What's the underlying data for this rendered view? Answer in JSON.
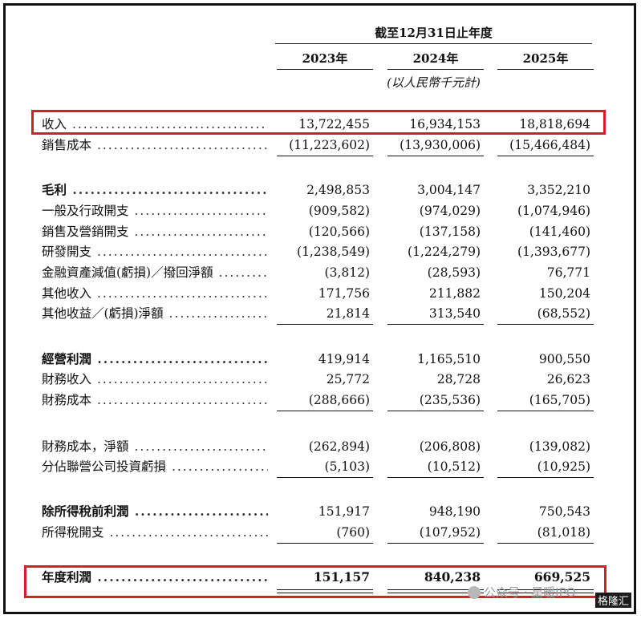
{
  "header": {
    "period": "截至12月31日止年度",
    "years": [
      "2023年",
      "2024年",
      "2025年"
    ],
    "unit": "(以人民幣千元計)"
  },
  "rows": [
    {
      "label": "收入",
      "bold": false,
      "values": [
        "13,722,455",
        "16,934,153",
        "18,818,694"
      ]
    },
    {
      "label": "銷售成本",
      "bold": false,
      "values": [
        "(11,223,602)",
        "(13,930,006)",
        "(15,466,484)"
      ]
    },
    {
      "label": "毛利",
      "bold": true,
      "values": [
        "2,498,853",
        "3,004,147",
        "3,352,210"
      ]
    },
    {
      "label": "一般及行政開支",
      "bold": false,
      "values": [
        "(909,582)",
        "(974,029)",
        "(1,074,946)"
      ]
    },
    {
      "label": "銷售及營銷開支",
      "bold": false,
      "values": [
        "(120,566)",
        "(137,158)",
        "(141,460)"
      ]
    },
    {
      "label": "研發開支",
      "bold": false,
      "values": [
        "(1,238,549)",
        "(1,224,279)",
        "(1,393,677)"
      ]
    },
    {
      "label": "金融資產減值(虧損)／撥回淨額",
      "bold": false,
      "values": [
        "(3,812)",
        "(28,593)",
        "76,771"
      ]
    },
    {
      "label": "其他收入",
      "bold": false,
      "values": [
        "171,756",
        "211,882",
        "150,204"
      ]
    },
    {
      "label": "其他收益／(虧損)淨額",
      "bold": false,
      "values": [
        "21,814",
        "313,540",
        "(68,552)"
      ]
    },
    {
      "label": "經營利潤",
      "bold": true,
      "values": [
        "419,914",
        "1,165,510",
        "900,550"
      ]
    },
    {
      "label": "財務收入",
      "bold": false,
      "values": [
        "25,772",
        "28,728",
        "26,623"
      ]
    },
    {
      "label": "財務成本",
      "bold": false,
      "values": [
        "(288,666)",
        "(235,536)",
        "(165,705)"
      ]
    },
    {
      "label": "財務成本，淨額",
      "bold": false,
      "values": [
        "(262,894)",
        "(206,808)",
        "(139,082)"
      ]
    },
    {
      "label": "分佔聯營公司投資虧損",
      "bold": false,
      "values": [
        "(5,103)",
        "(10,512)",
        "(10,925)"
      ]
    },
    {
      "label": "除所得稅前利潤",
      "bold": true,
      "values": [
        "151,917",
        "948,190",
        "750,543"
      ]
    },
    {
      "label": "所得稅開支",
      "bold": false,
      "values": [
        "(760)",
        "(107,952)",
        "(81,018)"
      ]
    },
    {
      "label": "年度利潤",
      "bold": true,
      "values": [
        "151,157",
        "840,238",
        "669,525"
      ]
    }
  ],
  "watermark": {
    "text": "公众号 · 星暖IPO",
    "icon": "wechat-icon"
  },
  "corner_logo": "格隆汇",
  "highlight_color": "#d3202a"
}
